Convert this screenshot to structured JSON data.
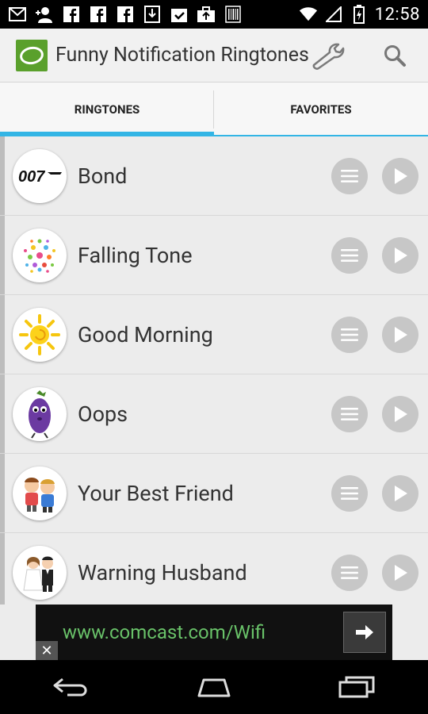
{
  "status_bar": {
    "time": "12:58",
    "icons": [
      "gmail-icon",
      "user-add-icon",
      "facebook-icon",
      "facebook-icon",
      "facebook-icon",
      "download-icon",
      "clipboard-check-icon",
      "briefcase-upload-icon",
      "barcode-icon"
    ],
    "right_icons": [
      "wifi-icon",
      "signal-icon",
      "battery-icon"
    ]
  },
  "action_bar": {
    "title": "Funny Notification Ringtones",
    "actions": [
      "settings-wrench-icon",
      "search-icon"
    ]
  },
  "tabs": [
    {
      "label": "RINGTONES",
      "selected": true
    },
    {
      "label": "FAVORITES",
      "selected": false
    }
  ],
  "ringtones": [
    {
      "title": "Bond",
      "thumb": "007-logo"
    },
    {
      "title": "Falling Tone",
      "thumb": "confetti"
    },
    {
      "title": "Good Morning",
      "thumb": "sun"
    },
    {
      "title": "Oops",
      "thumb": "eggplant-character"
    },
    {
      "title": "Your Best Friend",
      "thumb": "kids"
    },
    {
      "title": "Warning Husband",
      "thumb": "bride-groom"
    }
  ],
  "ad": {
    "text": "www.comcast.com/Wifi",
    "close_label": "✕"
  },
  "colors": {
    "accent": "#33b5e5",
    "list_bg": "#ececec",
    "button_gray": "#c7c7c7",
    "ad_text": "#69c269"
  }
}
